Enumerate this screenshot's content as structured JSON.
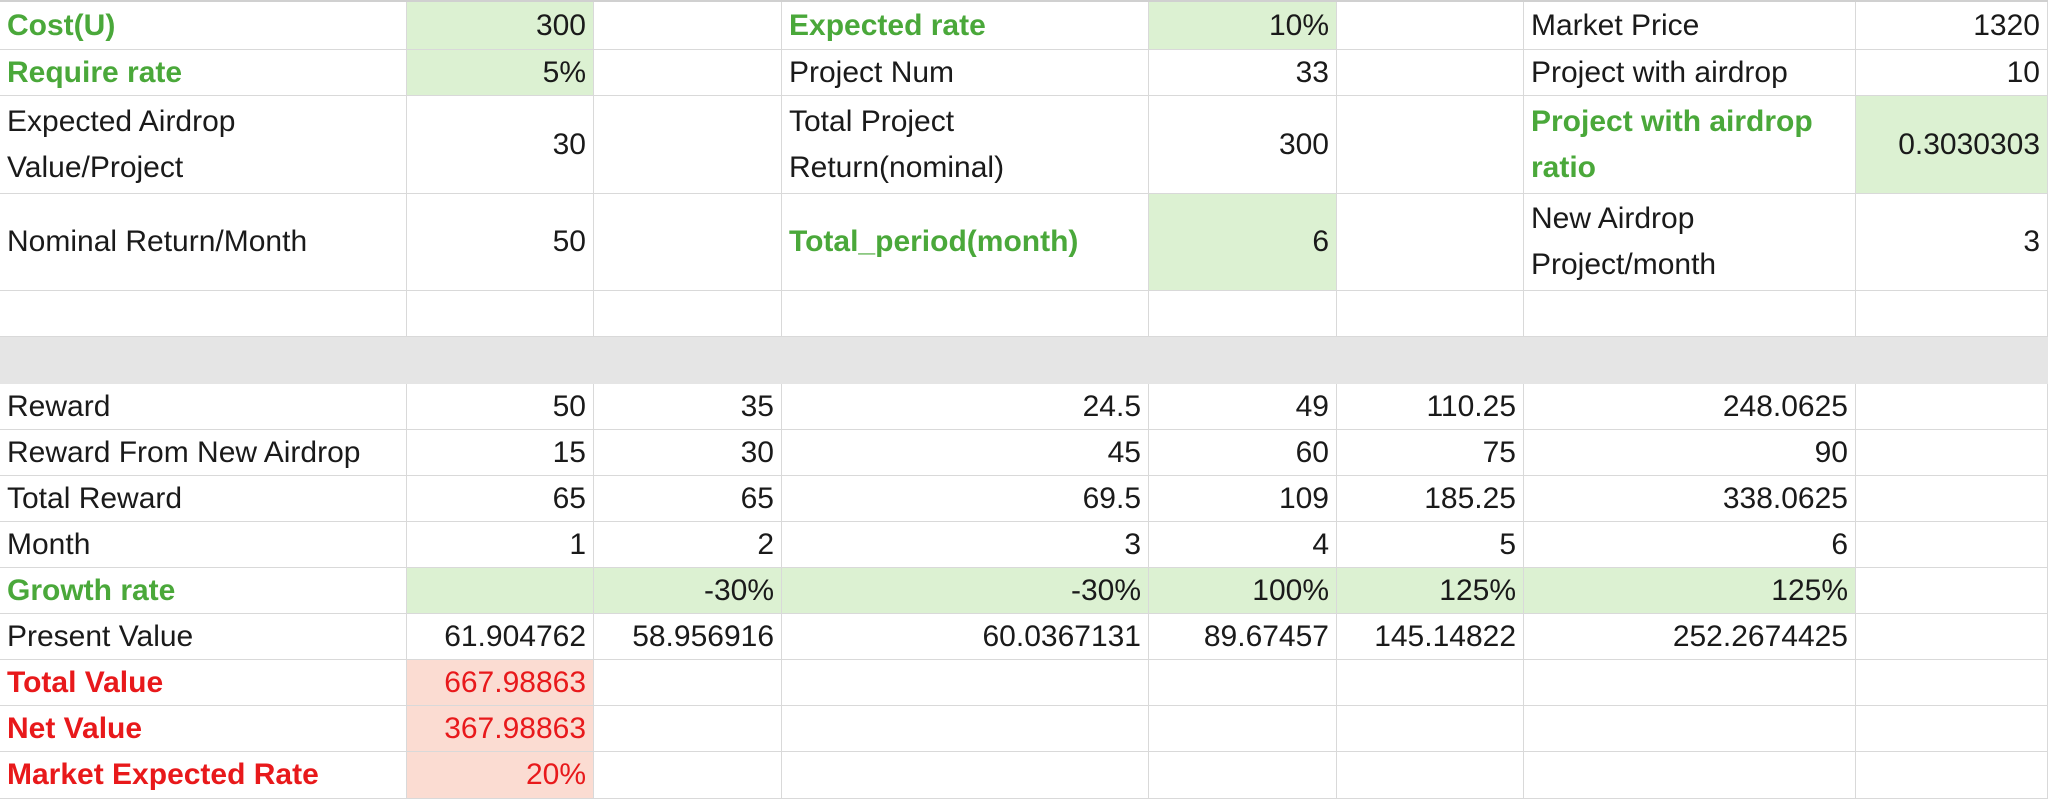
{
  "params": {
    "cost_label": "Cost(U)",
    "cost_value": "300",
    "require_rate_label": "Require rate",
    "require_rate_value": "5%",
    "expected_airdrop_label": "Expected Airdrop Value/Project",
    "expected_airdrop_value": "30",
    "nominal_return_label": "Nominal Return/Month",
    "nominal_return_value": "50",
    "expected_rate_label": "Expected rate",
    "expected_rate_value": "10%",
    "project_num_label": "Project Num",
    "project_num_value": "33",
    "total_project_return_label": "Total Project Return(nominal)",
    "total_project_return_value": "300",
    "total_period_label": "Total_period(month)",
    "total_period_value": "6",
    "market_price_label": "Market Price",
    "market_price_value": "1320",
    "project_with_airdrop_label": "Project with airdrop",
    "project_with_airdrop_value": "10",
    "project_with_airdrop_ratio_label": "Project with airdrop ratio",
    "project_with_airdrop_ratio_value": "0.3030303",
    "new_airdrop_label": "New Airdrop Project/month",
    "new_airdrop_value": "3"
  },
  "table": {
    "reward": {
      "label": "Reward",
      "values": [
        "50",
        "35",
        "24.5",
        "49",
        "110.25",
        "248.0625"
      ]
    },
    "reward_new_airdrop": {
      "label": "Reward From New Airdrop",
      "values": [
        "15",
        "30",
        "45",
        "60",
        "75",
        "90"
      ]
    },
    "total_reward": {
      "label": "Total Reward",
      "values": [
        "65",
        "65",
        "69.5",
        "109",
        "185.25",
        "338.0625"
      ]
    },
    "month": {
      "label": "Month",
      "values": [
        "1",
        "2",
        "3",
        "4",
        "5",
        "6"
      ]
    },
    "growth_rate": {
      "label": "Growth rate",
      "values": [
        "",
        "-30%",
        "-30%",
        "100%",
        "125%",
        "125%"
      ]
    },
    "present_value": {
      "label": "Present Value",
      "values": [
        "61.904762",
        "58.956916",
        "60.0367131",
        "89.67457",
        "145.14822",
        "252.2674425"
      ]
    }
  },
  "summary": {
    "total_value_label": "Total Value",
    "total_value": "667.98863",
    "net_value_label": "Net Value",
    "net_value": "367.98863",
    "market_expected_rate_label": "Market Expected Rate",
    "market_expected_rate": "20%"
  },
  "colors": {
    "green_text": "#4aa83a",
    "green_fill": "#dcf1d2",
    "red_text": "#e8191b",
    "pink_fill": "#fbdcd2",
    "grid": "#d9d9d9"
  }
}
